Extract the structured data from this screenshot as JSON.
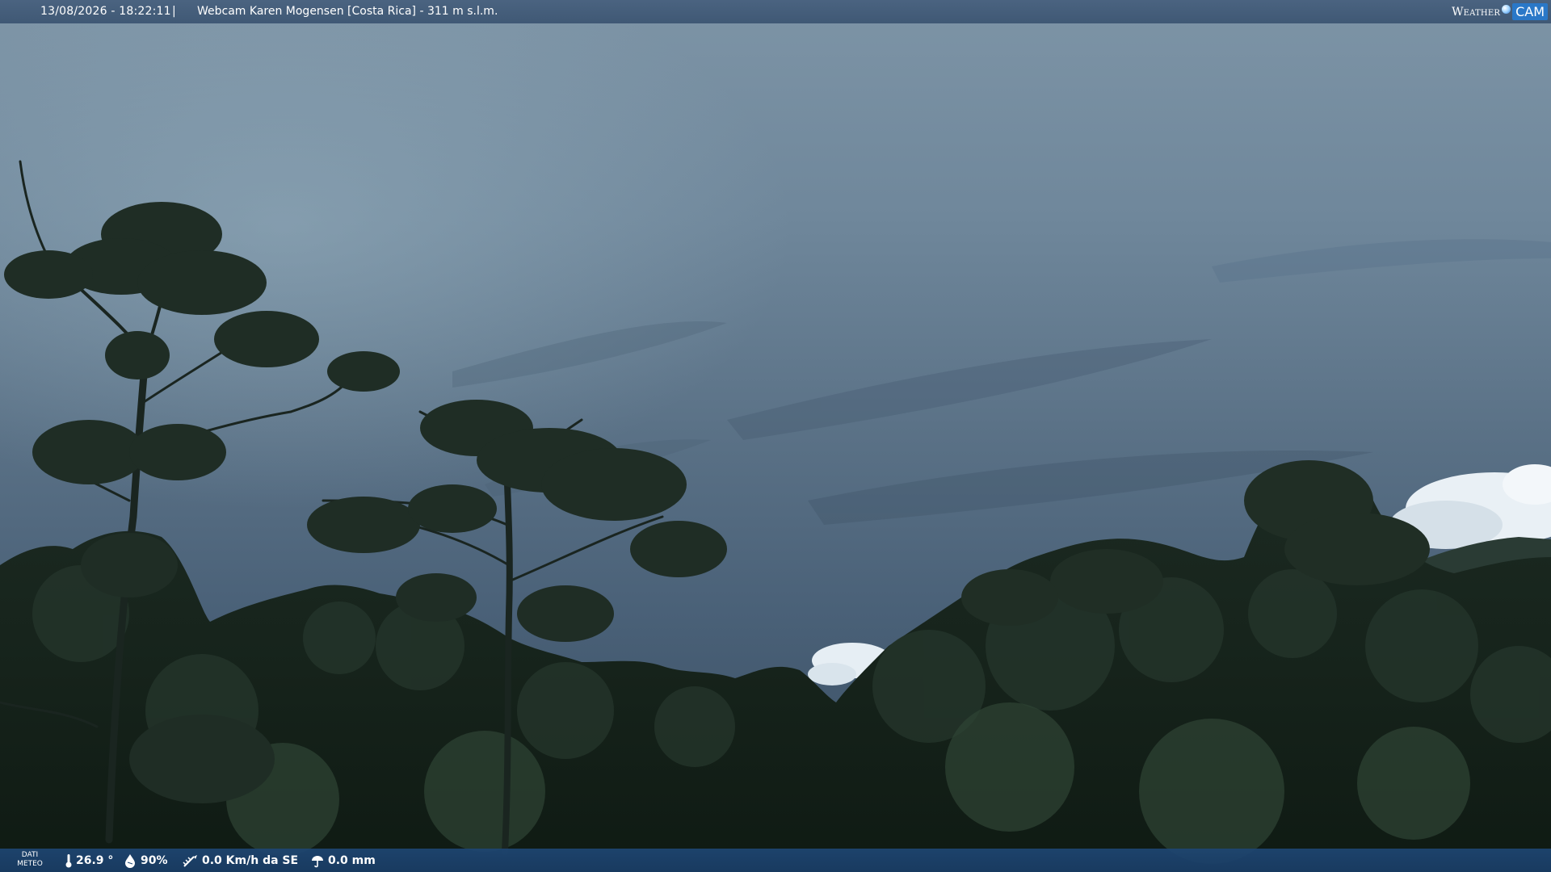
{
  "header": {
    "datetime": "13/08/2026 - 18:22:11",
    "separator": "|",
    "camera_title": "Webcam Karen Mogensen [Costa Rica]  - 311 m s.l.m."
  },
  "logo": {
    "weather": "Weather",
    "cam": "CAM"
  },
  "weather_bar": {
    "label_line1": "DATI",
    "label_line2": "METEO",
    "temperature": "26.9 °",
    "humidity": "90%",
    "wind": "0.0 Km/h da SE",
    "rain": "0.0 mm",
    "icons": [
      "thermometer-icon",
      "humidity-icon",
      "wind-icon",
      "rain-gauge-icon"
    ]
  },
  "colors": {
    "top_bar": "#4a6580",
    "bottom_bar": "#1e4673",
    "logo_accent": "#2a78c8"
  }
}
